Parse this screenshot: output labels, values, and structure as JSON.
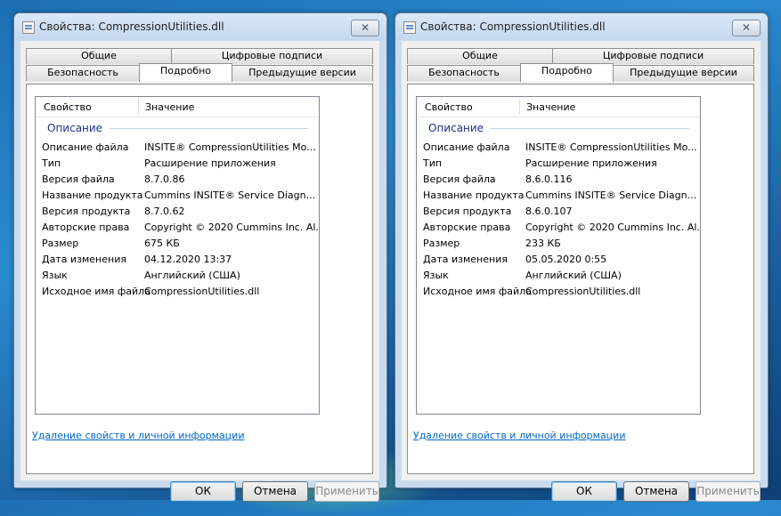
{
  "windows": [
    {
      "title": "Свойства: CompressionUtilities.dll",
      "tabs": {
        "general": "Общие",
        "signatures": "Цифровые подписи",
        "security": "Безопасность",
        "details": "Подробно",
        "previous": "Предыдущие версии"
      },
      "columns": {
        "property": "Свойство",
        "value": "Значение"
      },
      "group": "Описание",
      "rows": [
        {
          "k": "Описание файла",
          "v": "INSITE® CompressionUtilities Mo..."
        },
        {
          "k": "Тип",
          "v": "Расширение приложения"
        },
        {
          "k": "Версия файла",
          "v": "8.7.0.86"
        },
        {
          "k": "Название продукта",
          "v": "Cummins INSITE® Service Diagn..."
        },
        {
          "k": "Версия продукта",
          "v": "8.7.0.62"
        },
        {
          "k": "Авторские права",
          "v": "Copyright © 2020 Cummins Inc. Al..."
        },
        {
          "k": "Размер",
          "v": "675 КБ"
        },
        {
          "k": "Дата изменения",
          "v": "04.12.2020 13:37"
        },
        {
          "k": "Язык",
          "v": "Английский (США)"
        },
        {
          "k": "Исходное имя файла",
          "v": "CompressionUtilities.dll"
        }
      ],
      "link": "Удаление свойств и личной информации",
      "buttons": {
        "ok": "ОК",
        "cancel": "Отмена",
        "apply": "Применить"
      }
    },
    {
      "title": "Свойства: CompressionUtilities.dll",
      "tabs": {
        "general": "Общие",
        "signatures": "Цифровые подписи",
        "security": "Безопасность",
        "details": "Подробно",
        "previous": "Предыдущие версии"
      },
      "columns": {
        "property": "Свойство",
        "value": "Значение"
      },
      "group": "Описание",
      "rows": [
        {
          "k": "Описание файла",
          "v": "INSITE® CompressionUtilities Mo..."
        },
        {
          "k": "Тип",
          "v": "Расширение приложения"
        },
        {
          "k": "Версия файла",
          "v": "8.6.0.116"
        },
        {
          "k": "Название продукта",
          "v": "Cummins INSITE® Service Diagn..."
        },
        {
          "k": "Версия продукта",
          "v": "8.6.0.107"
        },
        {
          "k": "Авторские права",
          "v": "Copyright © 2020 Cummins Inc. Al..."
        },
        {
          "k": "Размер",
          "v": "233 КБ"
        },
        {
          "k": "Дата изменения",
          "v": "05.05.2020 0:55"
        },
        {
          "k": "Язык",
          "v": "Английский (США)"
        },
        {
          "k": "Исходное имя файла",
          "v": "CompressionUtilities.dll"
        }
      ],
      "link": "Удаление свойств и личной информации",
      "buttons": {
        "ok": "ОК",
        "cancel": "Отмена",
        "apply": "Применить"
      }
    }
  ],
  "icons": {
    "close": "close-icon",
    "dll": "dll-file-icon"
  }
}
